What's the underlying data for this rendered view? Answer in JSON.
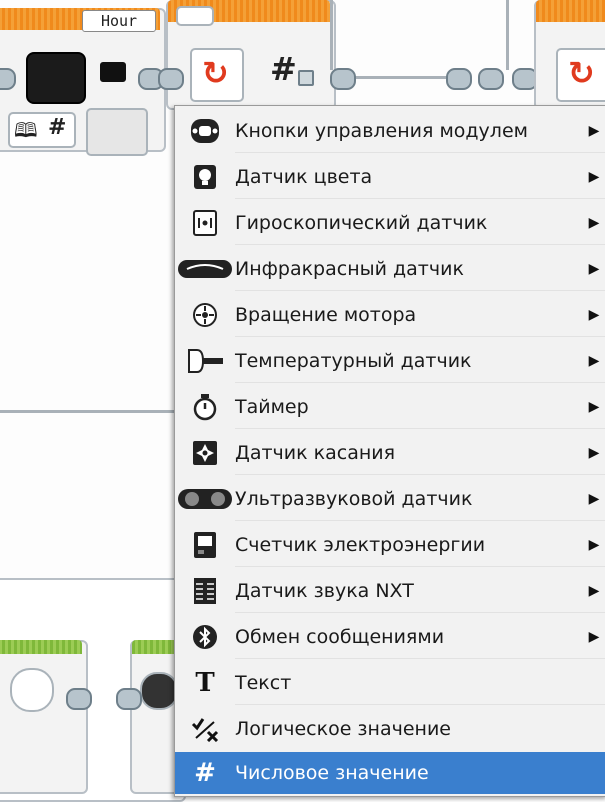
{
  "background_blocks": {
    "hour_label": "Hour",
    "hash_symbol": "#"
  },
  "menu": {
    "items": [
      {
        "label": "Кнопки управления модулем",
        "icon": "brick-buttons-icon",
        "has_submenu": true
      },
      {
        "label": "Датчик цвета",
        "icon": "color-sensor-icon",
        "has_submenu": true
      },
      {
        "label": "Гироскопический датчик",
        "icon": "gyro-sensor-icon",
        "has_submenu": true
      },
      {
        "label": "Инфракрасный датчик",
        "icon": "infrared-sensor-icon",
        "has_submenu": true
      },
      {
        "label": "Вращение мотора",
        "icon": "motor-rotation-icon",
        "has_submenu": true
      },
      {
        "label": "Температурный датчик",
        "icon": "temperature-sensor-icon",
        "has_submenu": true
      },
      {
        "label": "Таймер",
        "icon": "timer-icon",
        "has_submenu": true
      },
      {
        "label": "Датчик касания",
        "icon": "touch-sensor-icon",
        "has_submenu": true
      },
      {
        "label": "Ультразвуковой датчик",
        "icon": "ultrasonic-sensor-icon",
        "has_submenu": true
      },
      {
        "label": "Счетчик электроэнергии",
        "icon": "energy-meter-icon",
        "has_submenu": true
      },
      {
        "label": "Датчик звука NXT",
        "icon": "sound-sensor-icon",
        "has_submenu": true
      },
      {
        "label": "Обмен сообщениями",
        "icon": "bluetooth-messaging-icon",
        "has_submenu": true
      },
      {
        "label": "Текст",
        "icon": "text-icon",
        "has_submenu": false
      },
      {
        "label": "Логическое значение",
        "icon": "logic-value-icon",
        "has_submenu": false
      },
      {
        "label": "Числовое значение",
        "icon": "numeric-value-icon",
        "has_submenu": false,
        "selected": true
      }
    ],
    "submenu_arrow": "▶",
    "selected_color": "#3a7fce"
  }
}
